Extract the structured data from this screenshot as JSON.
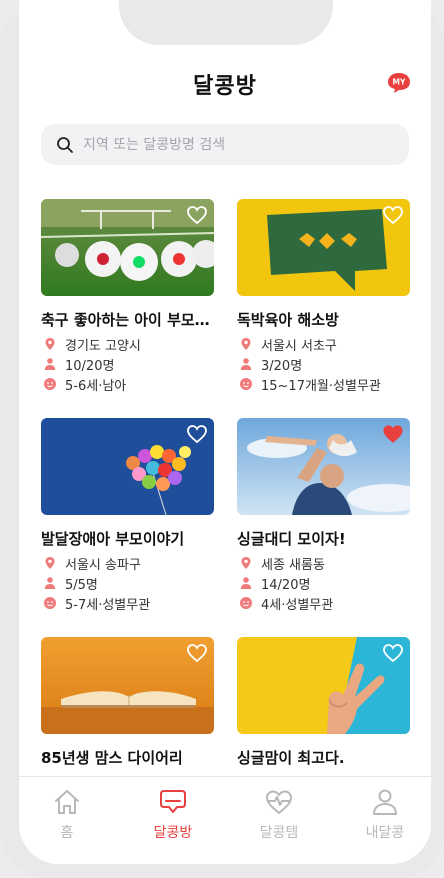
{
  "header": {
    "title": "달콩방",
    "my_badge": "MY"
  },
  "search": {
    "placeholder": "지역 또는 달콩방명 검색",
    "value": ""
  },
  "colors": {
    "accent": "#e8403f",
    "meta_icon": "#f07a7a",
    "inactive": "#b8b8bc"
  },
  "cards": [
    {
      "title": "축구 좋아하는 아이 부모…",
      "location": "경기도 고양시",
      "members": "10/20명",
      "age": "5-6세·남아",
      "liked": false,
      "image": "soccer-balls-on-grass"
    },
    {
      "title": "독박육아 해소방",
      "location": "서울시 서초구",
      "members": "3/20명",
      "age": "15~17개월·성별무관",
      "liked": false,
      "image": "speech-bubble-on-yellow"
    },
    {
      "title": "발달장애아 부모이야기",
      "location": "서울시 송파구",
      "members": "5/5명",
      "age": "5-7세·성별무관",
      "liked": false,
      "image": "balloons-on-blue"
    },
    {
      "title": "싱글대디 모이자!",
      "location": "세종 새롬동",
      "members": "14/20명",
      "age": "4세·성별무관",
      "liked": true,
      "image": "father-lifting-child"
    },
    {
      "title": "85년생 맘스 다이어리",
      "location": "",
      "members": "",
      "age": "",
      "liked": false,
      "image": "open-book-on-orange"
    },
    {
      "title": "싱글맘이 최고다.",
      "location": "",
      "members": "",
      "age": "",
      "liked": false,
      "image": "peace-sign-hand"
    }
  ],
  "nav": [
    {
      "label": "홈",
      "icon": "home-icon",
      "active": false
    },
    {
      "label": "달콩방",
      "icon": "chat-bubble-icon",
      "active": true
    },
    {
      "label": "달콩템",
      "icon": "heart-pulse-icon",
      "active": false
    },
    {
      "label": "내달콩",
      "icon": "person-icon",
      "active": false
    }
  ]
}
